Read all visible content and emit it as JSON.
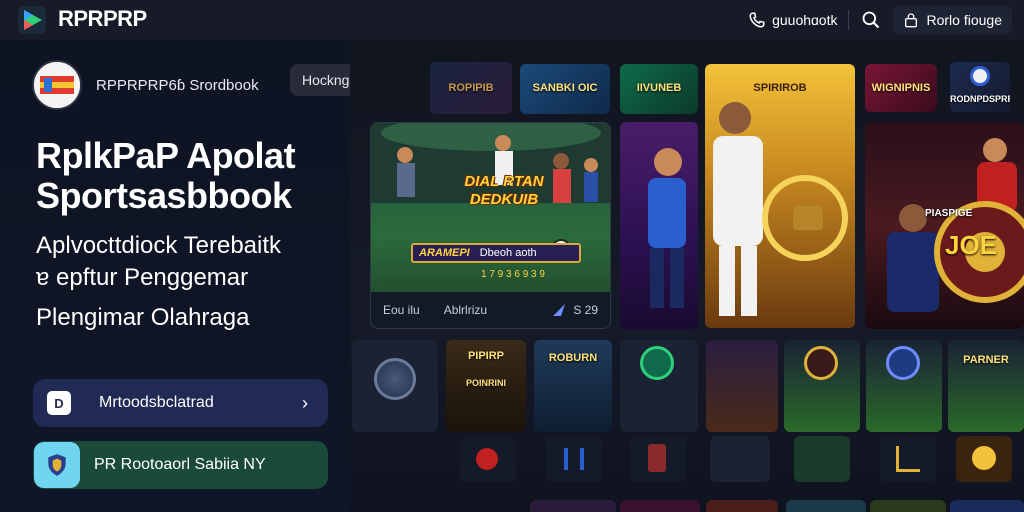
{
  "topbar": {
    "brand": "RPRPRP",
    "phone_text": "ɡuuohɑotk",
    "login_label": "Rorlo fiouge"
  },
  "left": {
    "app_name": "RPPRPRP6ɓ Srordbook",
    "tag_label": "Hockngaigr",
    "hero_title_line1": "RplkPaP Apolat",
    "hero_title_line2": "Sportsasbbook",
    "hero_sub_line1": "Aplvocttdiock Terebaitk",
    "hero_sub_line2": "ɐ epftur Penggemar",
    "hero_sub_line3": "Plengimar Olahraga",
    "cta_primary_label": "Mrtoodsbclatrad",
    "cta_secondary_label": "PR Rootoaorl Sabiia NY"
  },
  "gallery": {
    "top_tiles": [
      {
        "label": "ROPIPIB"
      },
      {
        "label": "SANBKI OIC"
      },
      {
        "label": "IIVUNEB"
      },
      {
        "label": "SPIRIROB"
      },
      {
        "label": "WIGNIPNIS"
      },
      {
        "label": "RODNPDSPRP"
      }
    ],
    "feature": {
      "banner": "DIAL RTAN DEDKUIB",
      "strip_a": "ARAMEPI",
      "strip_b": "Dbeoh aoth",
      "score": "1 7 9 3 6 9 3 9",
      "footer_left": "Eou ilu",
      "footer_mid": "Ablrlrizu",
      "footer_right": "S 29"
    },
    "mid_right_label": "PIASPIGE",
    "big_right_label": "JOE",
    "row2_labels": [
      "PIPIRP",
      "POINRINI",
      "ROBURN",
      "PARNER"
    ]
  },
  "colors": {
    "background": "#0d1220",
    "topbar": "#161b27",
    "cta_primary": "#202a55",
    "cta_secondary": "#1a4a3a",
    "accent_gold": "#ffd23e"
  }
}
